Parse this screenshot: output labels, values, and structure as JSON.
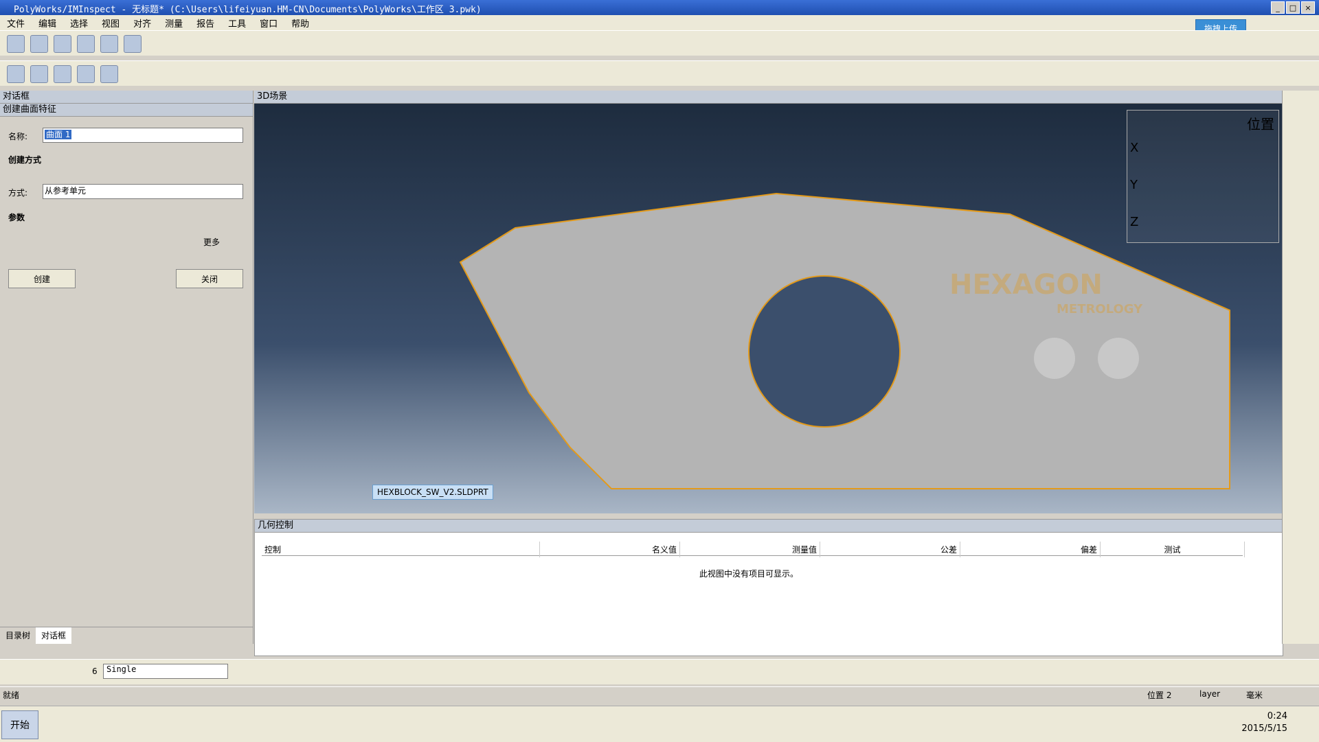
{
  "window": {
    "title": "PolyWorks/IMInspect - 无标题* (C:\\Users\\lifeiyuan.HM-CN\\Documents\\PolyWorks\\工作区 3.pwk)",
    "upload_label": "拖拽上传"
  },
  "menu": [
    "文件",
    "编辑",
    "选择",
    "视图",
    "对齐",
    "测量",
    "报告",
    "工具",
    "窗口",
    "帮助"
  ],
  "dialog": {
    "panel_title": "对话框",
    "subpanel_title": "创建曲面特征",
    "name_label": "名称:",
    "name_value": "曲面 1",
    "create_method_header": "创建方式",
    "method_label": "方式:",
    "method_value": "从参考单元",
    "params_header": "参数",
    "more_label": "更多",
    "create_button": "创建",
    "close_button": "关闭",
    "tabs": [
      "目录树",
      "对话框"
    ]
  },
  "scene": {
    "title": "3D场景",
    "part_label": "HEXBLOCK_SW_V2.SLDPRT",
    "watermark_main": "HEXAGON",
    "watermark_sub": "METROLOGY",
    "position_header": "位置",
    "position_rows": [
      "X",
      "Y",
      "Z"
    ]
  },
  "geometry": {
    "title": "几何控制",
    "columns": [
      "控制",
      "名义值",
      "测量值",
      "公差",
      "偏差",
      "测试"
    ],
    "empty_text": "此视图中没有项目可显示。"
  },
  "bottom_toolbar": {
    "count": "6",
    "mode": "Single"
  },
  "status": {
    "text": "就绪",
    "position": "位置 2",
    "layer": "layer",
    "unit": "毫米"
  },
  "taskbar": {
    "start_label": "开始",
    "time": "0:24",
    "date": "2015/5/15"
  }
}
